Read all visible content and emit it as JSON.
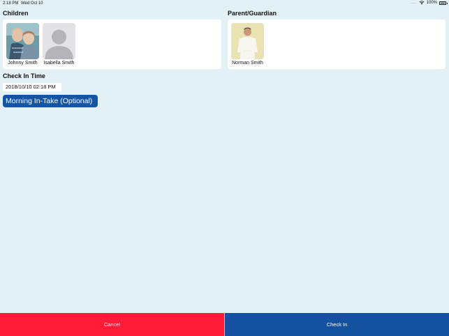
{
  "status_bar": {
    "time": "2:18 PM",
    "date": "Wed Oct 10",
    "dots": "....",
    "battery": "100%"
  },
  "children": {
    "title": "Children",
    "items": [
      {
        "name": "Johnny Smith",
        "photo": "children-photo"
      },
      {
        "name": "Isabella Smith",
        "photo": "default-avatar"
      }
    ]
  },
  "guardians": {
    "title": "Parent/Guardian",
    "items": [
      {
        "name": "Norman Smith",
        "photo": "guardian-photo"
      }
    ]
  },
  "check_in_time": {
    "title": "Check In Time",
    "value": "2018/10/10 02:18 PM"
  },
  "intake_button": "Morning In-Take (Optional)",
  "buttons": {
    "cancel": "Cancel",
    "check_in": "Check In"
  },
  "colors": {
    "background": "#e3f1f7",
    "cancel": "#ff1c39",
    "primary": "#14529f"
  }
}
